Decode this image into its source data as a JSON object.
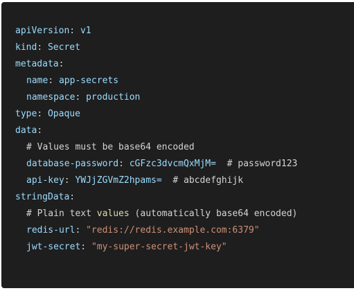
{
  "code": {
    "lines": [
      {
        "key": "apiVersion",
        "sep": ": ",
        "value": "v1"
      },
      {
        "key": "kind",
        "sep": ": ",
        "value": "Secret"
      },
      {
        "key": "metadata",
        "sep": ":"
      },
      {
        "key": "name",
        "sep": ": ",
        "value": "app-secrets"
      },
      {
        "key": "namespace",
        "sep": ": ",
        "value": "production"
      },
      {
        "key": "type",
        "sep": ": ",
        "value": "Opaque"
      },
      {
        "key": "data",
        "sep": ":"
      },
      {
        "comment": "# Values must be base64 encoded"
      },
      {
        "key": "database-password",
        "sep": ": ",
        "value": "cGFzc3dvcmQxMjM=",
        "trail": "  # password123"
      },
      {
        "key": "api-key",
        "sep": ": ",
        "value": "YWJjZGVmZ2hpams=",
        "trail": "  # abcdefghijk"
      },
      {
        "key": "stringData",
        "sep": ":"
      },
      {
        "comment_a": "# Plain text ",
        "comment_kw": "values",
        "comment_b": " (automatically base64 encoded)"
      },
      {
        "key": "redis-url",
        "sep": ": ",
        "str": "\"redis://redis.example.com:6379\""
      },
      {
        "key": "jwt-secret",
        "sep": ": ",
        "str": "\"my-super-secret-jwt-key\""
      }
    ]
  },
  "colors": {
    "background": "#1e1e1e",
    "key": "#9cdcfe",
    "string": "#ce9178",
    "highlight": "#dcdcaa",
    "text": "#d4d4d4"
  }
}
